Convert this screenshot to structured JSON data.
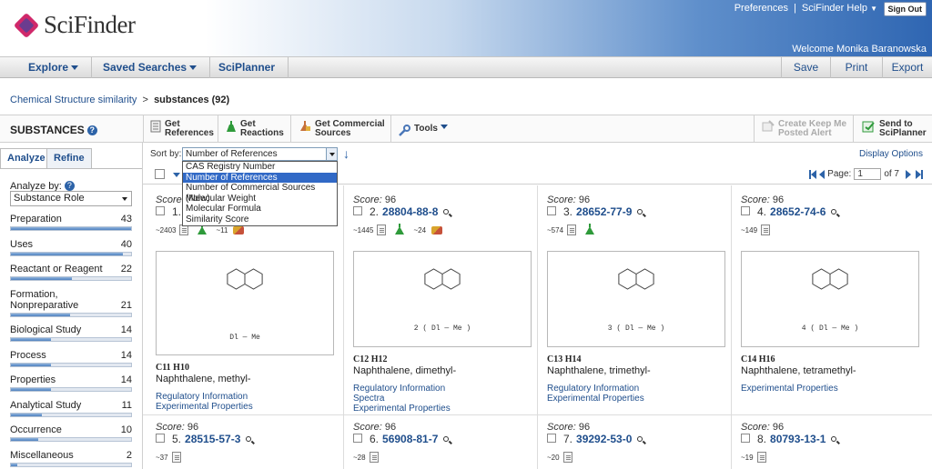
{
  "header": {
    "logo": "SciFinder",
    "links": [
      "Preferences",
      "SciFinder Help"
    ],
    "sign_out": "Sign Out",
    "welcome": "Welcome Monika Baranowska"
  },
  "nav": {
    "explore": "Explore",
    "saved_searches": "Saved Searches",
    "sciplanner": "SciPlanner",
    "save": "Save",
    "print": "Print",
    "export": "Export"
  },
  "breadcrumb": {
    "link": "Chemical Structure similarity",
    "separator": ">",
    "current": "substances (92)"
  },
  "toolbar": {
    "title": "SUBSTANCES",
    "help_icon": "?",
    "get_references": [
      "Get",
      "References"
    ],
    "get_reactions": [
      "Get",
      "Reactions"
    ],
    "get_commercial_sources": [
      "Get Commercial",
      "Sources"
    ],
    "tools": "Tools",
    "create_keep_me_posted_alert": [
      "Create Keep Me",
      "Posted Alert"
    ],
    "send_to_sciplanner": [
      "Send to",
      "SciPlanner"
    ]
  },
  "left": {
    "tabs": [
      "Analyze",
      "Refine"
    ],
    "analyze_by_label": "Analyze by:",
    "analyze_by_value": "Substance Role",
    "facets": [
      {
        "label": "Preparation",
        "count": "43",
        "fraction": 1.0
      },
      {
        "label": "Uses",
        "count": "40",
        "fraction": 0.93
      },
      {
        "label": "Reactant or Reagent",
        "count": "22",
        "fraction": 0.51
      },
      {
        "label": "Formation, Nonpreparative",
        "count": "21",
        "fraction": 0.49
      },
      {
        "label": "Biological Study",
        "count": "14",
        "fraction": 0.33
      },
      {
        "label": "Process",
        "count": "14",
        "fraction": 0.33
      },
      {
        "label": "Properties",
        "count": "14",
        "fraction": 0.33
      },
      {
        "label": "Analytical Study",
        "count": "11",
        "fraction": 0.26
      },
      {
        "label": "Occurrence",
        "count": "10",
        "fraction": 0.23
      },
      {
        "label": "Miscellaneous",
        "count": "2",
        "fraction": 0.05
      }
    ]
  },
  "sort": {
    "label": "Sort by:",
    "selected": "Number of References",
    "options": [
      "CAS Registry Number",
      "Number of References",
      "Number of Commercial Sources (New)",
      "Molecular Weight",
      "Molecular Formula",
      "Similarity Score"
    ],
    "display_options": "Display Options"
  },
  "pager": {
    "page_label": "Page:",
    "page_value": "1",
    "of": "of 7"
  },
  "results": [
    {
      "score_label": "Score:",
      "score": "",
      "index": "1.",
      "reg": "",
      "refs": "~2403",
      "sources": "~11",
      "sub": "Dl — Me",
      "formula": "C11 H10",
      "name": "Naphthalene, methyl-",
      "links": [
        "Regulatory Information",
        "Experimental Properties"
      ]
    },
    {
      "score_label": "Score:",
      "score": "96",
      "index": "2.",
      "reg": "28804-88-8",
      "refs": "~1445",
      "sources": "~24",
      "sub": "2 ( Dl — Me )",
      "formula": "C12 H12",
      "name": "Naphthalene, dimethyl-",
      "links": [
        "Regulatory Information",
        "Spectra",
        "Experimental Properties"
      ]
    },
    {
      "score_label": "Score:",
      "score": "96",
      "index": "3.",
      "reg": "28652-77-9",
      "refs": "~574",
      "sources": "",
      "sub": "3 ( Dl — Me )",
      "formula": "C13 H14",
      "name": "Naphthalene, trimethyl-",
      "links": [
        "Regulatory Information",
        "Experimental Properties"
      ]
    },
    {
      "score_label": "Score:",
      "score": "96",
      "index": "4.",
      "reg": "28652-74-6",
      "refs": "~149",
      "sources": "",
      "sub": "4 ( Dl — Me )",
      "formula": "C14 H16",
      "name": "Naphthalene, tetramethyl-",
      "links": [
        "Experimental Properties"
      ]
    },
    {
      "score_label": "Score:",
      "score": "96",
      "index": "5.",
      "reg": "28515-57-3",
      "refs": "~37"
    },
    {
      "score_label": "Score:",
      "score": "96",
      "index": "6.",
      "reg": "56908-81-7",
      "refs": "~28"
    },
    {
      "score_label": "Score:",
      "score": "96",
      "index": "7.",
      "reg": "39292-53-0",
      "refs": "~20"
    },
    {
      "score_label": "Score:",
      "score": "96",
      "index": "8.",
      "reg": "80793-13-1",
      "refs": "~19"
    }
  ]
}
